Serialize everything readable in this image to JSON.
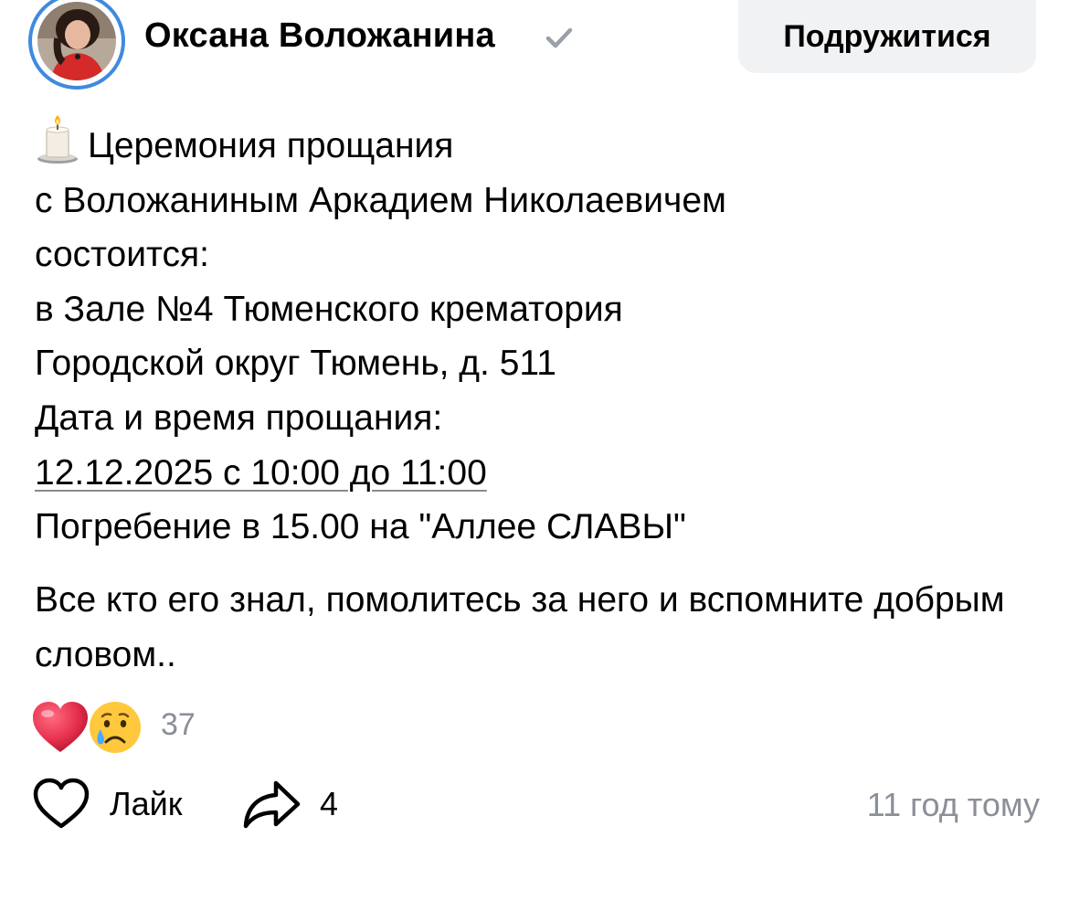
{
  "header": {
    "author_name": "Оксана Воложанина",
    "friend_button_label": "Подружитися",
    "accent_color": "#3f8ae0"
  },
  "post": {
    "lines": [
      "Церемония прощания",
      "с Воложаниным Аркадием Николаевичем",
      "состоится:",
      "в Зале №4 Тюменского крематория",
      "Городской округ Тюмень, д. 511",
      "Дата и время прощания:",
      "12.12.2025 с 10:00 до 11:00",
      "Погребение в 15.00 на \"Аллее СЛАВЫ\""
    ],
    "paragraph2": "Все кто его знал, помолитесь за него и вспомните добрым словом..",
    "leading_emoji": "candle-icon"
  },
  "reactions": {
    "icons": [
      "heart-reaction-icon",
      "crying-face-reaction-icon"
    ],
    "count": "37"
  },
  "actions": {
    "like_label": "Лайк",
    "share_count": "4",
    "time": "11 год тому"
  },
  "colors": {
    "secondary_text": "#8a8f98",
    "button_bg": "#f1f2f4",
    "heart_red": "#e8324e",
    "emoji_yellow": "#ffc83d"
  }
}
